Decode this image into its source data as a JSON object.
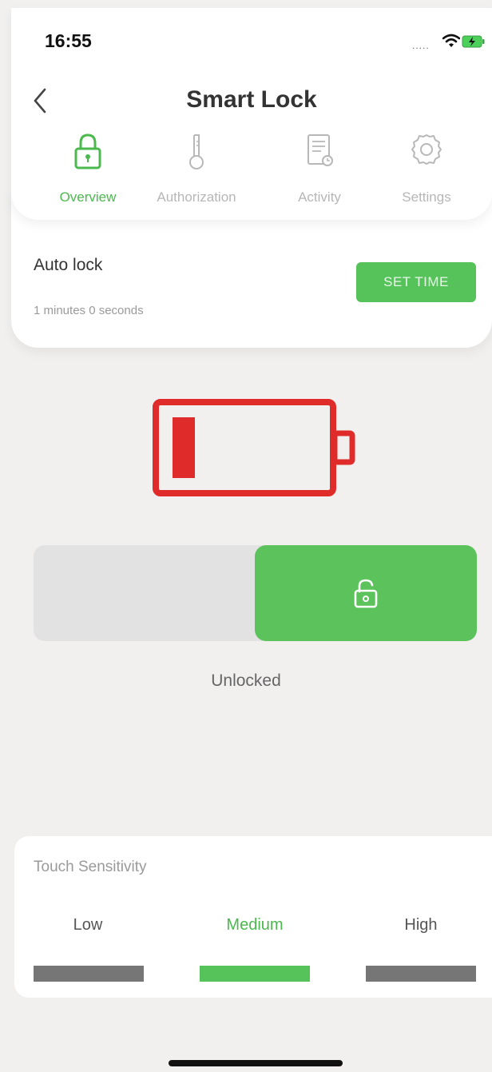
{
  "status_bar": {
    "time": "16:55",
    "signal_dots": "....."
  },
  "header": {
    "title": "Smart Lock"
  },
  "tabs": [
    {
      "label": "Overview",
      "icon": "lock-icon",
      "active": true
    },
    {
      "label": "Authorization",
      "icon": "key-icon",
      "active": false
    },
    {
      "label": "Activity",
      "icon": "activity-log-icon",
      "active": false
    },
    {
      "label": "Settings",
      "icon": "gear-icon",
      "active": false
    }
  ],
  "auto_lock": {
    "title": "Auto lock",
    "value": "1 minutes 0 seconds",
    "button_label": "SET TIME"
  },
  "lock_status": {
    "state": "Unlocked"
  },
  "touch_sensitivity": {
    "title": "Touch Sensitivity",
    "levels": [
      "Low",
      "Medium",
      "High"
    ],
    "selected": "Medium"
  },
  "colors": {
    "accent_green": "#56c25a",
    "battery_low_red": "#e02b2b",
    "inactive_gray": "#767676"
  }
}
